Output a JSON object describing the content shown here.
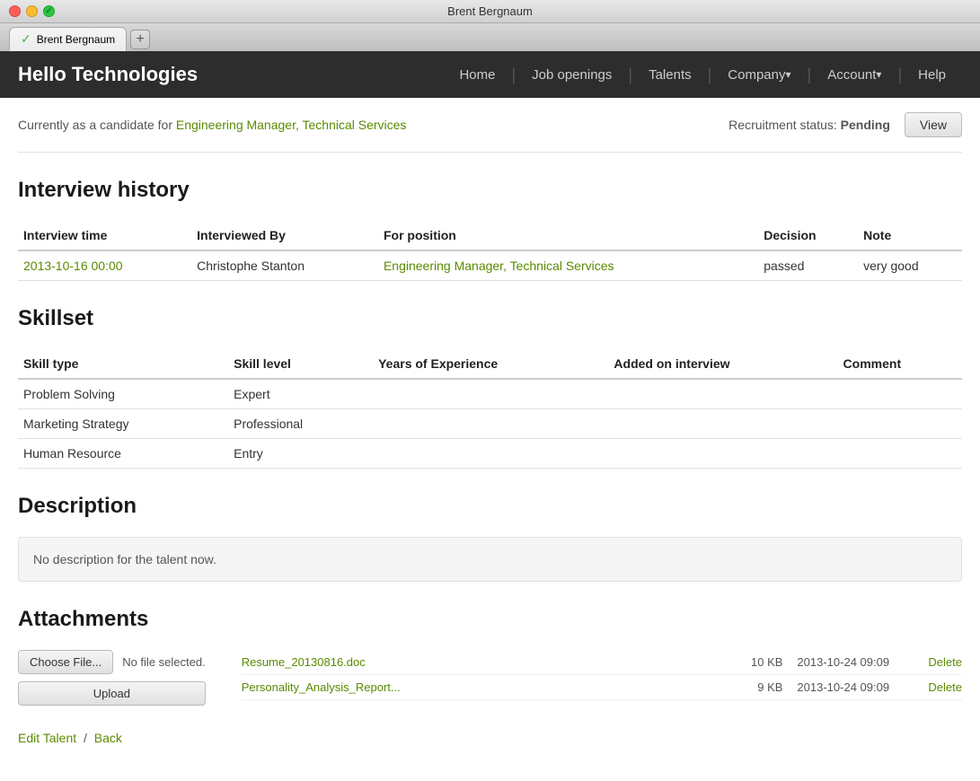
{
  "window": {
    "title": "Brent Bergnaum",
    "tab_label": "Brent Bergnaum"
  },
  "navbar": {
    "brand": "Hello Technologies",
    "links": [
      {
        "label": "Home",
        "has_arrow": false
      },
      {
        "label": "Job openings",
        "has_arrow": false
      },
      {
        "label": "Talents",
        "has_arrow": false
      },
      {
        "label": "Company",
        "has_arrow": true
      },
      {
        "label": "Account",
        "has_arrow": true
      },
      {
        "label": "Help",
        "has_arrow": false
      }
    ]
  },
  "candidate_bar": {
    "prefix": "Currently as a candidate for ",
    "position_link": "Engineering Manager, Technical Services",
    "status_label": "Recruitment status: ",
    "status_value": "Pending",
    "view_button": "View"
  },
  "interview_history": {
    "section_title": "Interview history",
    "columns": [
      "Interview time",
      "Interviewed By",
      "For position",
      "Decision",
      "Note"
    ],
    "rows": [
      {
        "interview_time": "2013-10-16 00:00",
        "interviewed_by": "Christophe Stanton",
        "for_position": "Engineering Manager, Technical Services",
        "decision": "passed",
        "note": "very good"
      }
    ]
  },
  "skillset": {
    "section_title": "Skillset",
    "columns": [
      "Skill type",
      "Skill level",
      "Years of Experience",
      "Added on interview",
      "Comment"
    ],
    "rows": [
      {
        "skill_type": "Problem Solving",
        "skill_level": "Expert",
        "years": "",
        "added_on": "",
        "comment": ""
      },
      {
        "skill_type": "Marketing Strategy",
        "skill_level": "Professional",
        "years": "",
        "added_on": "",
        "comment": ""
      },
      {
        "skill_type": "Human Resource",
        "skill_level": "Entry",
        "years": "",
        "added_on": "",
        "comment": ""
      }
    ]
  },
  "description": {
    "section_title": "Description",
    "text": "No description for the talent now."
  },
  "attachments": {
    "section_title": "Attachments",
    "choose_file_label": "Choose File...",
    "upload_label": "Upload",
    "no_file_text": "No file selected.",
    "files": [
      {
        "name": "Resume_20130816.doc",
        "size": "10 KB",
        "date": "2013-10-24 09:09",
        "delete_label": "Delete"
      },
      {
        "name": "Personality_Analysis_Report...",
        "size": "9 KB",
        "date": "2013-10-24 09:09",
        "delete_label": "Delete"
      }
    ]
  },
  "footer": {
    "edit_label": "Edit Talent",
    "separator": "/",
    "back_label": "Back"
  },
  "colors": {
    "accent": "#5a8a00",
    "brand_bg": "#2d2d2d"
  }
}
